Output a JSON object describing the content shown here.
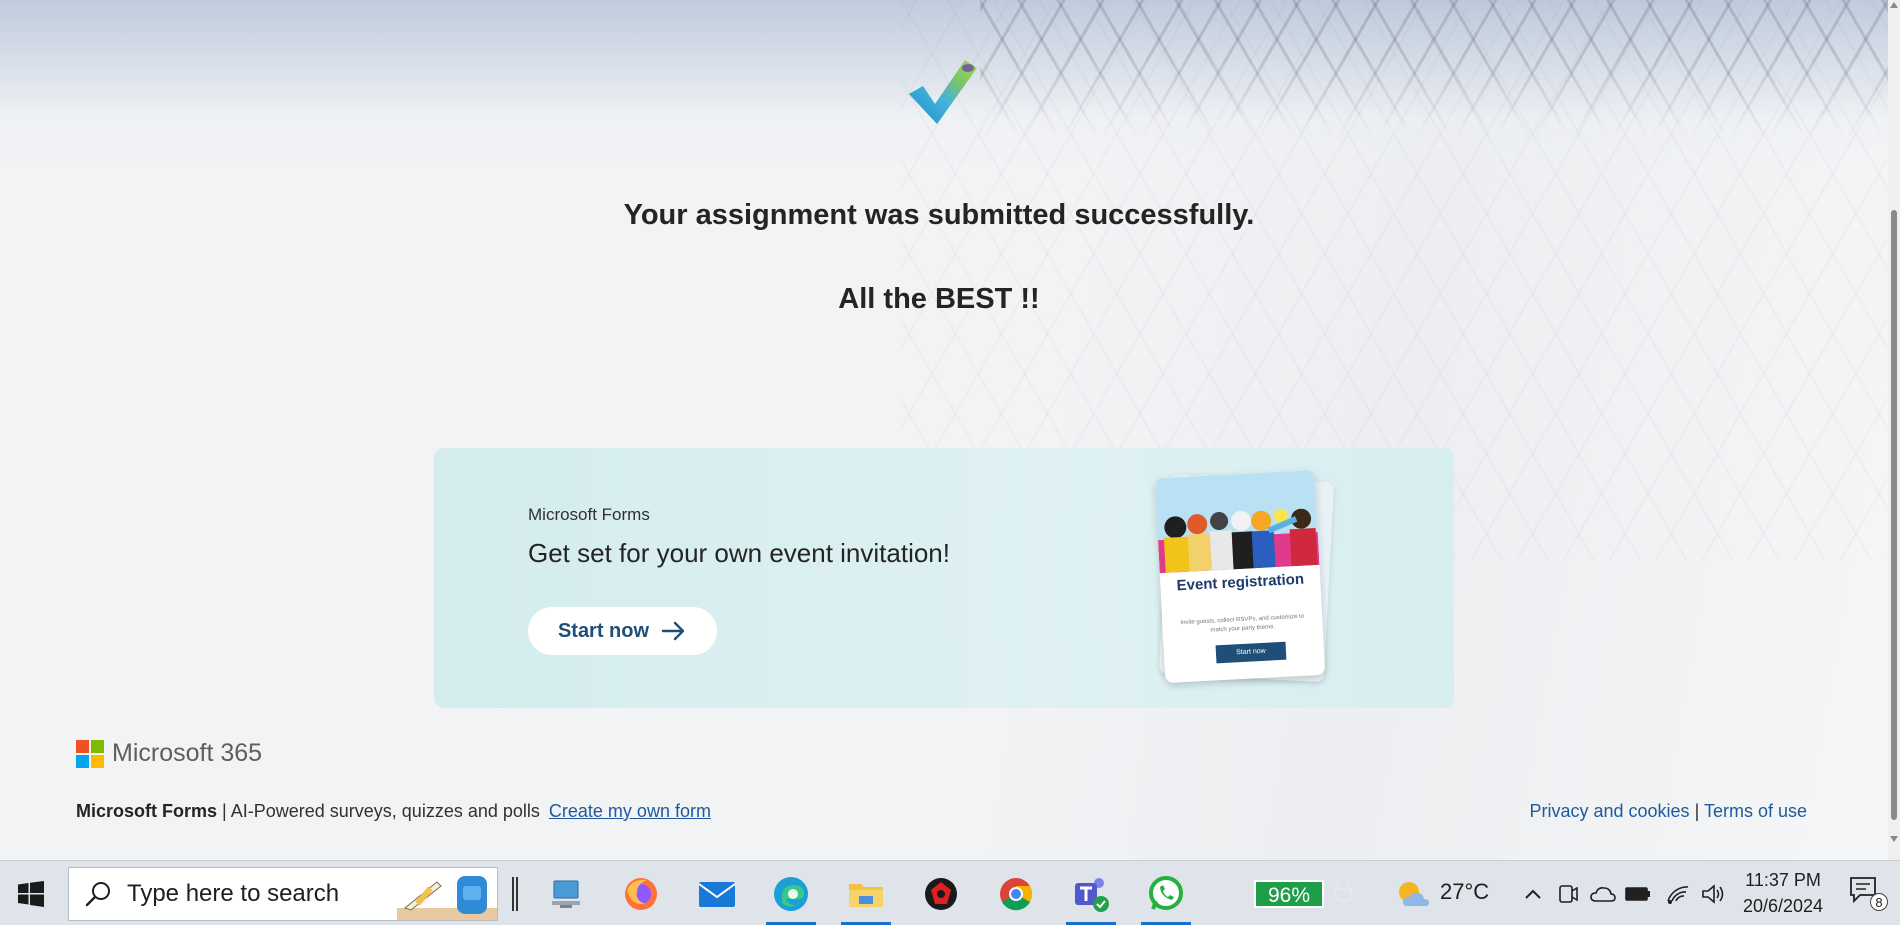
{
  "page": {
    "success_message": "Your assignment was submitted successfully.",
    "best_message": "All the BEST !!"
  },
  "promo": {
    "brand": "Microsoft Forms",
    "title": "Get set for your own event invitation!",
    "button_label": "Start now",
    "card_title": "Event registration",
    "card_desc": "Invite guests, collect RSVPs, and customize to match your party theme.",
    "card_button": "Start now"
  },
  "footer": {
    "logo_text": "Microsoft 365",
    "product_name": "Microsoft Forms",
    "separator": "|",
    "tagline": "AI-Powered surveys, quizzes and polls",
    "create_link": "Create my own form",
    "privacy_link": "Privacy and cookies",
    "separator_right": "|",
    "terms_link": "Terms of use"
  },
  "taskbar": {
    "search_placeholder": "Type here to search",
    "battery": "96%",
    "temperature": "27°C",
    "time": "11:37 PM",
    "date": "20/6/2024",
    "notification_count": "8",
    "apps": [
      "task-view",
      "this-pc",
      "firefox",
      "mail",
      "edge",
      "file-explorer",
      "app-red",
      "chrome",
      "teams",
      "whatsapp"
    ]
  },
  "colors": {
    "accent": "#1f4e79",
    "link": "#1e5a9c",
    "promo_bg": "#d4ecee",
    "battery": "#1f9e4a"
  }
}
